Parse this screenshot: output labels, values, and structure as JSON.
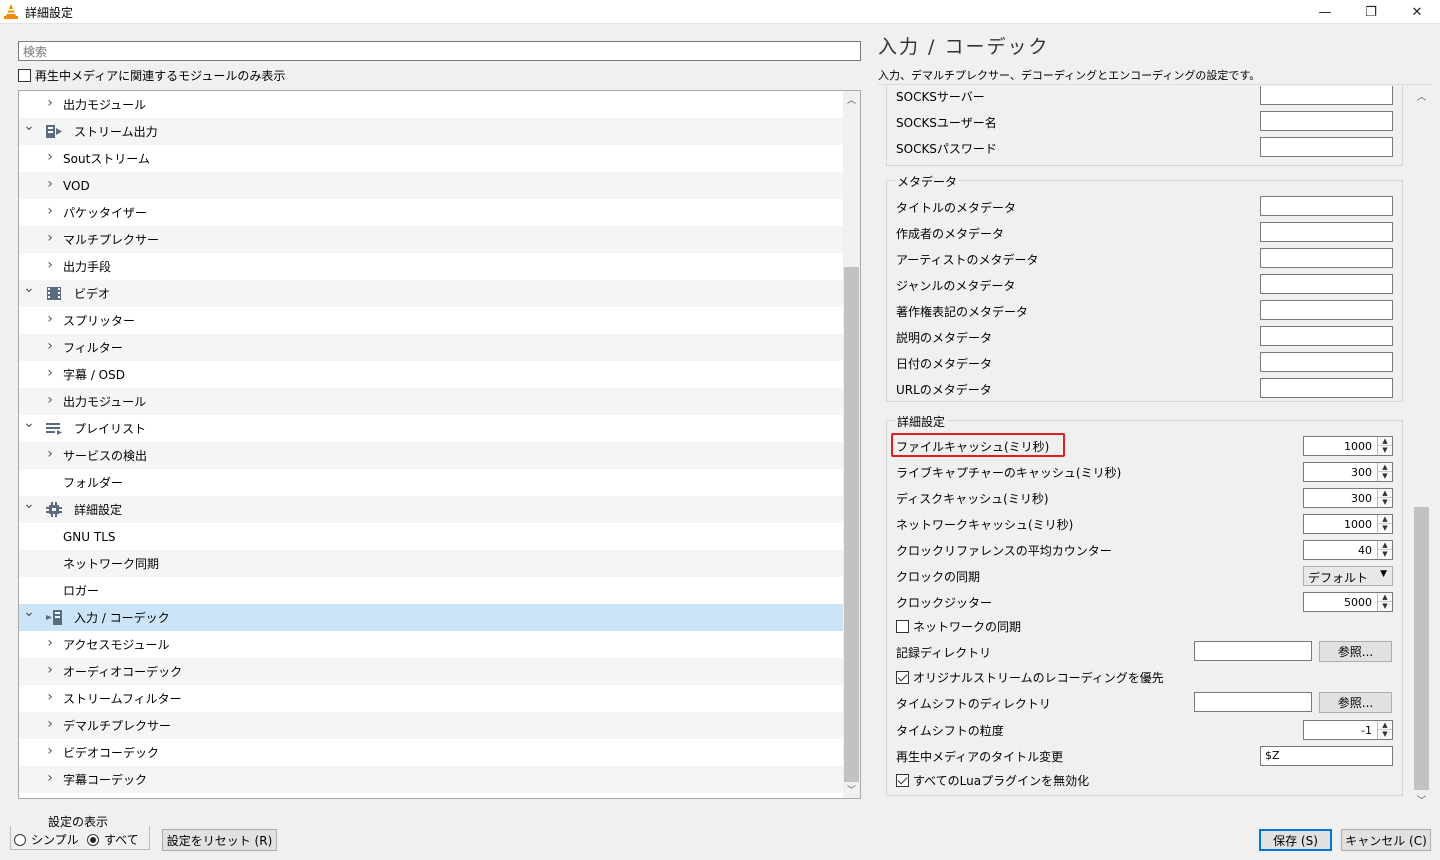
{
  "window": {
    "title": "詳細設定",
    "minimize": "—",
    "maximize": "❐",
    "close": "✕"
  },
  "left": {
    "search_placeholder": "検索",
    "only_current_label": "再生中メディアに関連するモジュールのみ表示",
    "tree": [
      {
        "label": "出力モジュール",
        "level": 2,
        "expander": "right"
      },
      {
        "label": "ストリーム出力",
        "level": 1,
        "expander": "down",
        "icon": "stream-output-icon"
      },
      {
        "label": "Soutストリーム",
        "level": 2,
        "expander": "right"
      },
      {
        "label": "VOD",
        "level": 2,
        "expander": "right"
      },
      {
        "label": "パケッタイザー",
        "level": 2,
        "expander": "right"
      },
      {
        "label": "マルチプレクサー",
        "level": 2,
        "expander": "right"
      },
      {
        "label": "出力手段",
        "level": 2,
        "expander": "right"
      },
      {
        "label": "ビデオ",
        "level": 1,
        "expander": "down",
        "icon": "video-icon"
      },
      {
        "label": "スプリッター",
        "level": 2,
        "expander": "right"
      },
      {
        "label": "フィルター",
        "level": 2,
        "expander": "right"
      },
      {
        "label": "字幕 / OSD",
        "level": 2,
        "expander": "right"
      },
      {
        "label": "出力モジュール",
        "level": 2,
        "expander": "right"
      },
      {
        "label": "プレイリスト",
        "level": 1,
        "expander": "down",
        "icon": "playlist-icon"
      },
      {
        "label": "サービスの検出",
        "level": 2,
        "expander": "right"
      },
      {
        "label": "フォルダー",
        "level": 2,
        "expander": "none"
      },
      {
        "label": "詳細設定",
        "level": 1,
        "expander": "down",
        "icon": "advanced-icon"
      },
      {
        "label": "GNU TLS",
        "level": 2,
        "expander": "none"
      },
      {
        "label": "ネットワーク同期",
        "level": 2,
        "expander": "none"
      },
      {
        "label": "ロガー",
        "level": 2,
        "expander": "none"
      },
      {
        "label": "入力 / コーデック",
        "level": 1,
        "expander": "down",
        "icon": "input-codec-icon",
        "selected": true
      },
      {
        "label": "アクセスモジュール",
        "level": 2,
        "expander": "right"
      },
      {
        "label": "オーディオコーデック",
        "level": 2,
        "expander": "right"
      },
      {
        "label": "ストリームフィルター",
        "level": 2,
        "expander": "right"
      },
      {
        "label": "デマルチプレクサー",
        "level": 2,
        "expander": "right"
      },
      {
        "label": "ビデオコーデック",
        "level": 2,
        "expander": "right"
      },
      {
        "label": "字幕コーデック",
        "level": 2,
        "expander": "right"
      }
    ],
    "show_settings_label": "設定の表示",
    "radio_simple": "シンプル",
    "radio_all": "すべて",
    "reset_button": "設定をリセット (R)"
  },
  "right": {
    "title": "入力 / コーデック",
    "description": "入力、デマルチプレクサー、デコーディングとエンコーディングの設定です。",
    "socks_rows": [
      {
        "label": "SOCKSサーバー",
        "value": ""
      },
      {
        "label": "SOCKSユーザー名",
        "value": ""
      },
      {
        "label": "SOCKSパスワード",
        "value": ""
      }
    ],
    "metadata_title": "メタデータ",
    "metadata_rows": [
      {
        "label": "タイトルのメタデータ",
        "value": ""
      },
      {
        "label": "作成者のメタデータ",
        "value": ""
      },
      {
        "label": "アーティストのメタデータ",
        "value": ""
      },
      {
        "label": "ジャンルのメタデータ",
        "value": ""
      },
      {
        "label": "著作権表記のメタデータ",
        "value": ""
      },
      {
        "label": "説明のメタデータ",
        "value": ""
      },
      {
        "label": "日付のメタデータ",
        "value": ""
      },
      {
        "label": "URLのメタデータ",
        "value": ""
      }
    ],
    "advanced_title": "詳細設定",
    "file_caching_label": "ファイルキャッシュ(ミリ秒)",
    "file_caching_value": "1000",
    "live_caching_label": "ライブキャプチャーのキャッシュ(ミリ秒)",
    "live_caching_value": "300",
    "disc_caching_label": "ディスクキャッシュ(ミリ秒)",
    "disc_caching_value": "300",
    "network_caching_label": "ネットワークキャッシュ(ミリ秒)",
    "network_caching_value": "1000",
    "clock_avg_label": "クロックリファレンスの平均カウンター",
    "clock_avg_value": "40",
    "clock_sync_label": "クロックの同期",
    "clock_sync_value": "デフォルト",
    "clock_jitter_label": "クロックジッター",
    "clock_jitter_value": "5000",
    "network_sync_label": "ネットワークの同期",
    "record_dir_label": "記録ディレクトリ",
    "record_dir_value": "",
    "browse_label": "参照...",
    "prefer_original_label": "オリジナルストリームのレコーディングを優先",
    "timeshift_dir_label": "タイムシフトのディレクトリ",
    "timeshift_dir_value": "",
    "timeshift_gran_label": "タイムシフトの粒度",
    "timeshift_gran_value": "-1",
    "title_change_label": "再生中メディアのタイトル変更",
    "title_change_value": "$Z",
    "disable_lua_label": "すべてのLuaプラグインを無効化"
  },
  "footer": {
    "save_button": "保存 (S)",
    "cancel_button": "キャンセル (C)"
  }
}
